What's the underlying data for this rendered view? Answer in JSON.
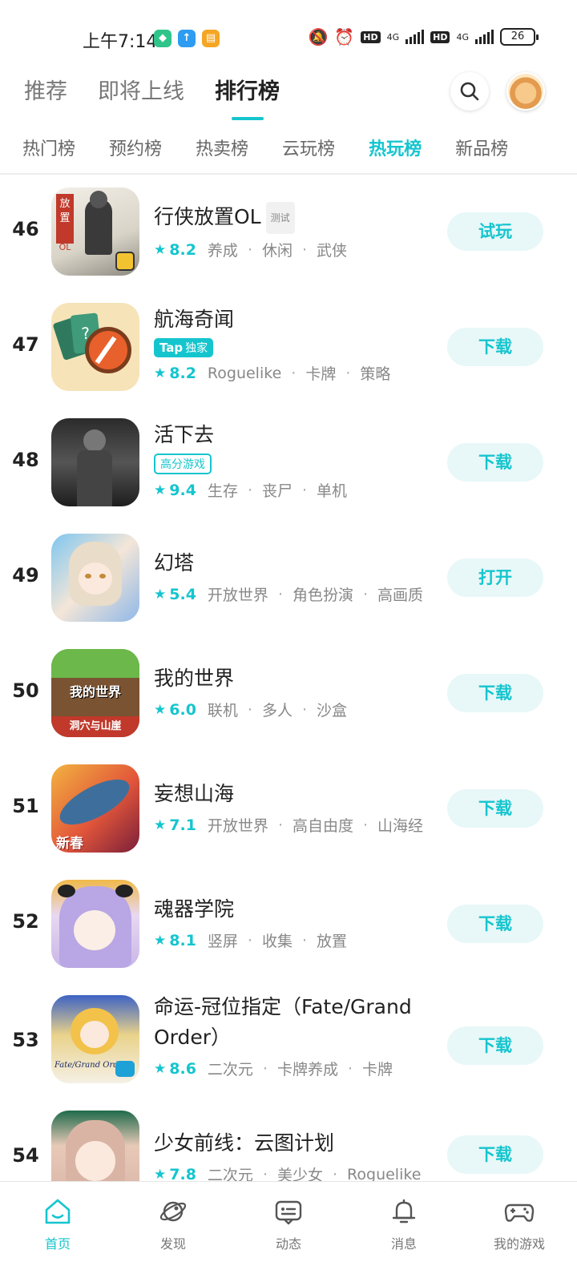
{
  "status_bar": {
    "time": "上午7:14",
    "network_1": "4G",
    "network_2": "4G",
    "hd_1": "HD",
    "hd_2": "HD",
    "battery": "26"
  },
  "top_tabs": [
    {
      "label": "推荐",
      "active": false
    },
    {
      "label": "即将上线",
      "active": false
    },
    {
      "label": "排行榜",
      "active": true
    }
  ],
  "sub_tabs": [
    {
      "label": "热门榜",
      "active": false
    },
    {
      "label": "预约榜",
      "active": false
    },
    {
      "label": "热卖榜",
      "active": false
    },
    {
      "label": "云玩榜",
      "active": false
    },
    {
      "label": "热玩榜",
      "active": true
    },
    {
      "label": "新品榜",
      "active": false
    }
  ],
  "games": [
    {
      "rank": "46",
      "name": "行侠放置OL",
      "tag": "测试",
      "badge": "",
      "rating": "8.2",
      "genres": [
        "养成",
        "休闲",
        "武侠"
      ],
      "action": "试玩"
    },
    {
      "rank": "47",
      "name": "航海奇闻",
      "tag": "",
      "badge": "Tap独家",
      "rating": "8.2",
      "genres": [
        "Roguelike",
        "卡牌",
        "策略"
      ],
      "action": "下载"
    },
    {
      "rank": "48",
      "name": "活下去",
      "tag": "",
      "badge": "高分游戏",
      "rating": "9.4",
      "genres": [
        "生存",
        "丧尸",
        "单机"
      ],
      "action": "下载"
    },
    {
      "rank": "49",
      "name": "幻塔",
      "tag": "",
      "badge": "",
      "rating": "5.4",
      "genres": [
        "开放世界",
        "角色扮演",
        "高画质"
      ],
      "action": "打开"
    },
    {
      "rank": "50",
      "name": "我的世界",
      "tag": "",
      "badge": "",
      "rating": "6.0",
      "genres": [
        "联机",
        "多人",
        "沙盒"
      ],
      "action": "下载"
    },
    {
      "rank": "51",
      "name": "妄想山海",
      "tag": "",
      "badge": "",
      "rating": "7.1",
      "genres": [
        "开放世界",
        "高自由度",
        "山海经"
      ],
      "action": "下载"
    },
    {
      "rank": "52",
      "name": "魂器学院",
      "tag": "",
      "badge": "",
      "rating": "8.1",
      "genres": [
        "竖屏",
        "收集",
        "放置"
      ],
      "action": "下载"
    },
    {
      "rank": "53",
      "name": "命运-冠位指定（Fate/Grand Order）",
      "tag": "",
      "badge": "",
      "rating": "8.6",
      "genres": [
        "二次元",
        "卡牌养成",
        "卡牌"
      ],
      "action": "下载"
    },
    {
      "rank": "54",
      "name": "少女前线：云图计划",
      "tag": "",
      "badge": "",
      "rating": "7.8",
      "genres": [
        "二次元",
        "美少女",
        "Roguelike"
      ],
      "action": "下载"
    }
  ],
  "icon_art": {
    "46": "icon-text-放置OL",
    "50": "icon-text-我的世界-洞穴与山崖",
    "51": "icon-text-新春",
    "53": "icon-text-Fate-Grand-Order"
  },
  "icon_text": {
    "g46": "放置",
    "g46b": "OL",
    "g50a": "我的世界",
    "g50b": "洞穴与山崖",
    "g51": "新春",
    "g53": "Fate/Grand Order"
  },
  "bottom_nav": [
    {
      "label": "首页",
      "icon": "home-icon",
      "active": true
    },
    {
      "label": "发现",
      "icon": "discover-icon",
      "active": false
    },
    {
      "label": "动态",
      "icon": "feed-icon",
      "active": false
    },
    {
      "label": "消息",
      "icon": "bell-icon",
      "active": false
    },
    {
      "label": "我的游戏",
      "icon": "gamepad-icon",
      "active": false
    }
  ],
  "colors": {
    "accent": "#15c5ce",
    "accent_light": "#e8f7f8",
    "text_primary": "#222222",
    "text_secondary": "#888888"
  }
}
